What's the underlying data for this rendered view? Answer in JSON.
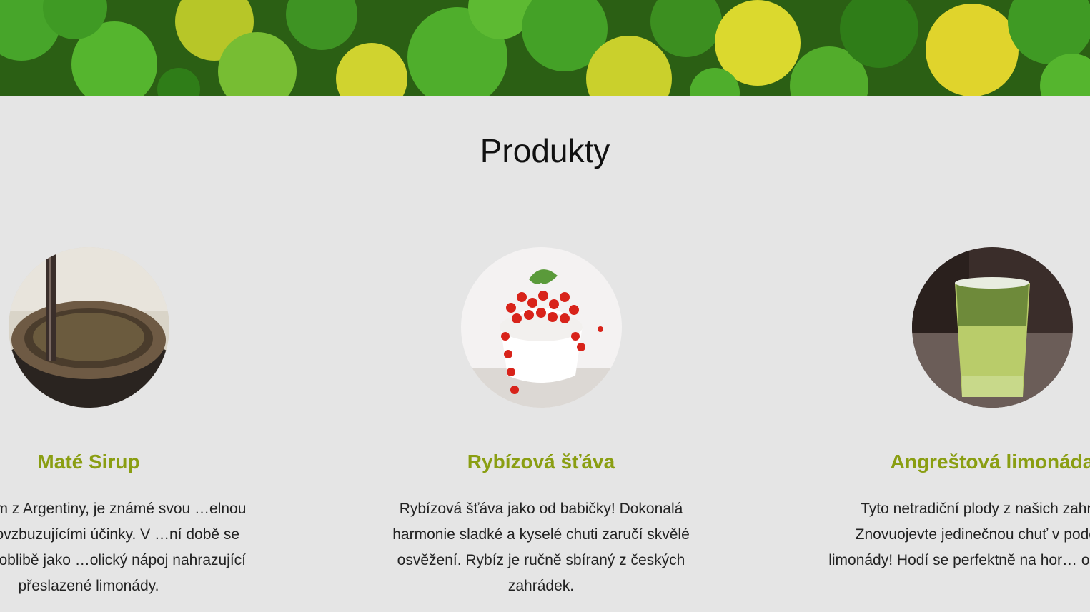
{
  "hero": {
    "image": "citrus-limes-lemons-banner",
    "colors": {
      "lime": "#4fae2c",
      "lemon": "#d4d62a",
      "dark": "#1f4d0d"
    }
  },
  "section": {
    "title": "Produkty"
  },
  "products": [
    {
      "image": "mate-gourd-photo",
      "name": "Maté Sirup",
      "description": "…původem z Argentiny, je známé svou …elnou chutí a povzbuzujícími účinky. V …ní době se těší velké oblibě jako …olický nápoj nahrazující přeslazené limonády."
    },
    {
      "image": "red-currants-bowl-photo",
      "name": "Rybízová šťáva",
      "description": "Rybízová šťáva jako od babičky! Dokonalá harmonie sladké a kyselé chuti zaručí skvělé osvěžení. Rybíz je ručně sbíraný z českých zahrádek."
    },
    {
      "image": "gooseberry-lemonade-glass-photo",
      "name": "Angreštová limonáda",
      "description": "Tyto netradiční plody z našich zahrád… Znovuojevte jedinečnou chuť v podobě… limonády! Hodí se perfektně na hor… odpoledne."
    }
  ],
  "colors": {
    "background": "#e5e5e5",
    "accent": "#8a9e12",
    "text": "#222222"
  }
}
